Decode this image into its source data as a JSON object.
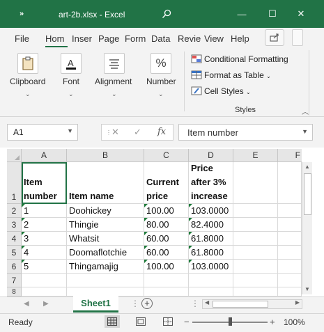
{
  "window": {
    "quick_access": "»",
    "title": "art-2b.xlsx  -  Excel",
    "search_icon": "search-icon",
    "minimize": "—",
    "maximize": "☐",
    "close": "✕"
  },
  "menu": {
    "tabs": [
      "File",
      "Hom",
      "Inser",
      "Page",
      "Form",
      "Data",
      "Revie",
      "View",
      "Help"
    ],
    "active": "Hom"
  },
  "ribbon": {
    "clipboard": "Clipboard",
    "font": "Font",
    "alignment": "Alignment",
    "number": "Number",
    "number_icon": "%",
    "styles": {
      "items": [
        "Conditional Formatting",
        "Format as Table",
        "Cell Styles"
      ],
      "caption": "Styles"
    }
  },
  "formula_bar": {
    "name_box": "A1",
    "cancel": "✕",
    "enter": "✓",
    "fx": "fx",
    "content": "Item number"
  },
  "sheet": {
    "columns": [
      "A",
      "B",
      "C",
      "D",
      "E",
      "F"
    ],
    "rows": [
      "1",
      "2",
      "3",
      "4",
      "5",
      "6",
      "7",
      "8"
    ],
    "header": [
      "Item number",
      "Item name",
      "Current price",
      "Price after 3% increase"
    ],
    "data": [
      [
        "1",
        "Doohickey",
        "100.00",
        "103.0000"
      ],
      [
        "2",
        "Thingie",
        "80.00",
        "82.4000"
      ],
      [
        "3",
        "Whatsit",
        "60.00",
        "61.8000"
      ],
      [
        "4",
        "Doomaflotchie",
        "60.00",
        "61.8000"
      ],
      [
        "5",
        "Thingamajig",
        "100.00",
        "103.0000"
      ]
    ]
  },
  "tabs": {
    "sheet1": "Sheet1",
    "add": "+"
  },
  "status": {
    "ready": "Ready",
    "zoom": "100%",
    "zoom_minus": "−",
    "zoom_plus": "+"
  }
}
